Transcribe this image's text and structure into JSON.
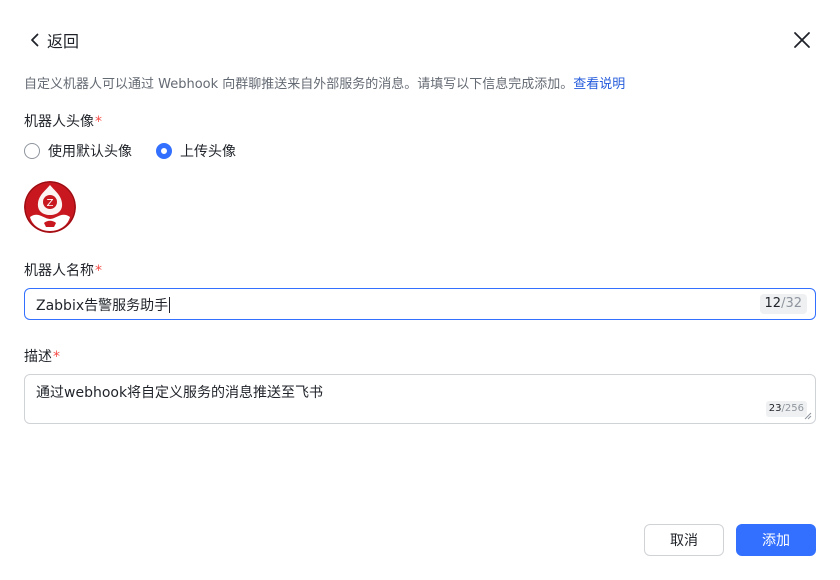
{
  "header": {
    "back_label": "返回",
    "back_icon": "chevron-left-icon",
    "close_icon": "close-icon"
  },
  "description": {
    "text": "自定义机器人可以通过 Webhook 向群聊推送来自外部服务的消息。请填写以下信息完成添加。",
    "link": "查看说明"
  },
  "avatar_section": {
    "label": "机器人头像",
    "required_mark": "*",
    "options": [
      {
        "label": "使用默认头像",
        "selected": false
      },
      {
        "label": "上传头像",
        "selected": true
      }
    ],
    "avatar_letter": "Z"
  },
  "name_field": {
    "label": "机器人名称",
    "required_mark": "*",
    "value": "Zabbix告警服务助手",
    "count": "12",
    "max": "/32"
  },
  "desc_field": {
    "label": "描述",
    "required_mark": "*",
    "value": "通过webhook将自定义服务的消息推送至飞书",
    "count": "23",
    "max": "/256"
  },
  "footer": {
    "cancel_label": "取消",
    "add_label": "添加"
  },
  "colors": {
    "accent": "#3370ff",
    "link": "#245bdb",
    "required": "#f54a45",
    "avatar_red": "#c8171e"
  }
}
